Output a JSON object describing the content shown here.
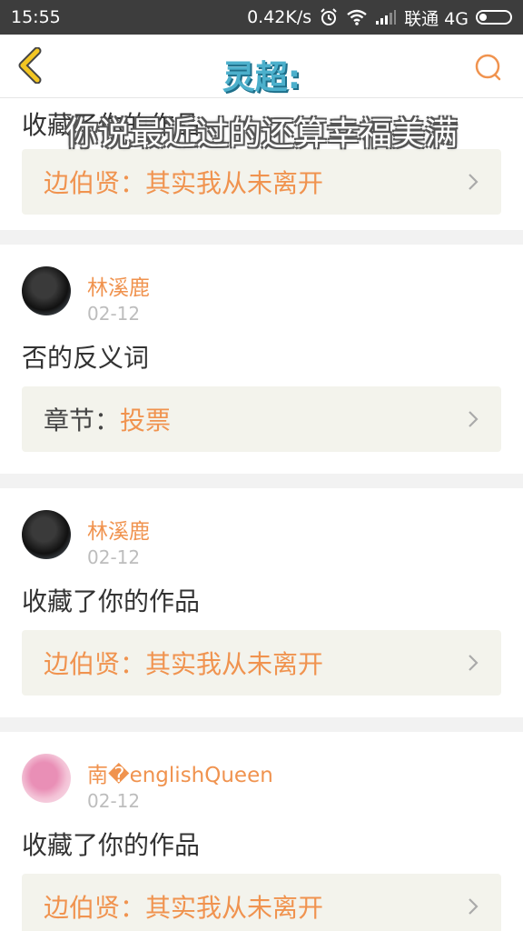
{
  "status_bar": {
    "time": "15:55",
    "speed": "0.42K/s",
    "carrier": "联通 4G"
  },
  "header": {
    "title": "灵超:"
  },
  "lyric_overlay": "你说最近过的还算幸福美满",
  "feed": [
    {
      "action": "收藏了你的作品",
      "work_label": "边伯贤：",
      "work_title": "其实我从未离开"
    },
    {
      "user": "林溪鹿",
      "date": "02-12",
      "action": "否的反义词",
      "work_label": "章节：",
      "work_title": "投票"
    },
    {
      "user": "林溪鹿",
      "date": "02-12",
      "action": "收藏了你的作品",
      "work_label": "边伯贤：",
      "work_title": "其实我从未离开"
    },
    {
      "user": "南�englishQueen",
      "date": "02-12",
      "action": "收藏了你的作品",
      "work_label": "边伯贤：",
      "work_title": "其实我从未离开"
    }
  ],
  "colors": {
    "accent": "#f0934f",
    "title": "#4cb0cc",
    "statusbar": "#3d3d3d"
  }
}
